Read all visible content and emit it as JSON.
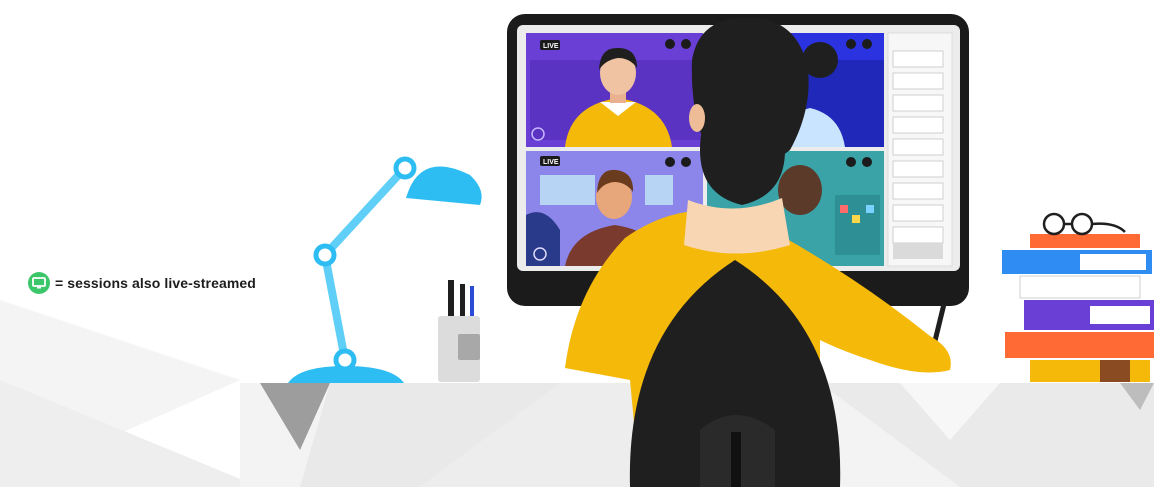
{
  "legend": {
    "text": "= sessions also live-streamed",
    "icon": "screen-icon",
    "icon_color": "#3cc66a"
  },
  "tiles": [
    {
      "badge": "LIVE",
      "bg": "#6a3fd6"
    },
    {
      "badge": "",
      "bg": "#2b33e0"
    },
    {
      "badge": "LIVE",
      "bg": "#8c86ea"
    },
    {
      "badge": "",
      "bg": "#3aa3a8"
    }
  ],
  "colors": {
    "lamp": "#2ebdf3",
    "shirt": "#f5b90a",
    "chair": "#1f1f1f",
    "monitor_frame": "#1b1b1b"
  }
}
